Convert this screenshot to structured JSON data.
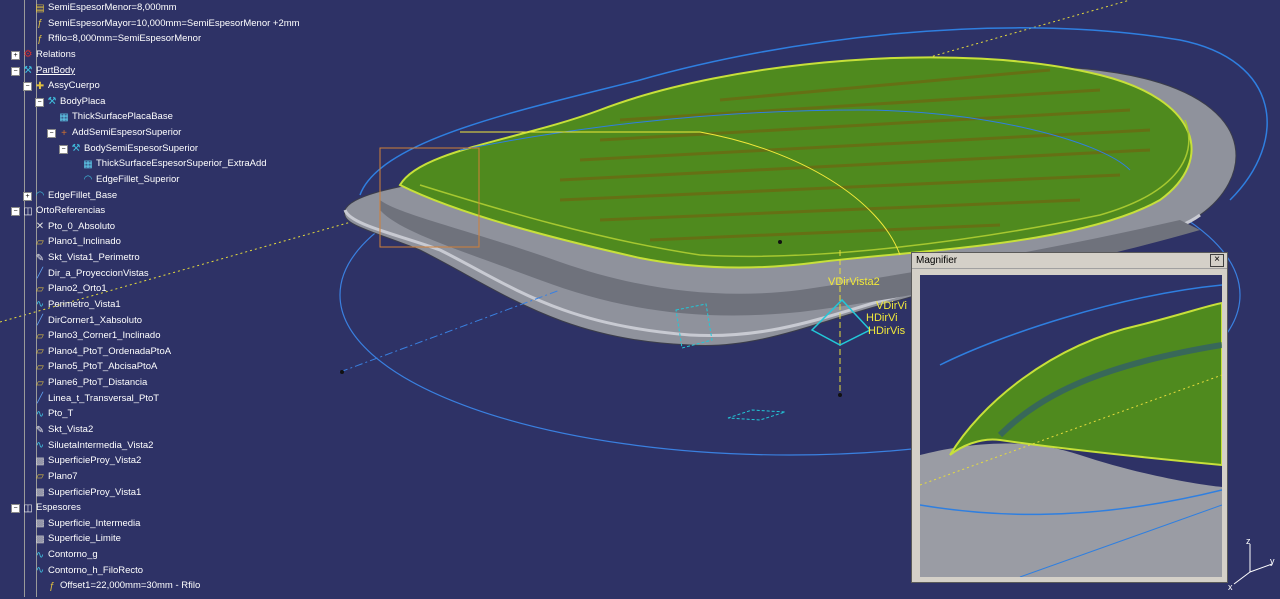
{
  "tree": {
    "nodes": [
      {
        "label": "SemiEspesorMenor=8,000mm",
        "icon": "parameter-icon"
      },
      {
        "label": "SemiEspesorMayor=10,000mm=SemiEspesorMenor +2mm",
        "icon": "formula-icon"
      },
      {
        "label": "Rfilo=8,000mm=SemiEspesorMenor",
        "icon": "formula-icon"
      },
      {
        "label": "Relations",
        "icon": "relations-icon"
      },
      {
        "label": "PartBody",
        "icon": "partbody-icon"
      },
      {
        "label": "AssyCuerpo",
        "icon": "assemble-icon"
      },
      {
        "label": "BodyPlaca",
        "icon": "body-icon"
      },
      {
        "label": "ThickSurfacePlacaBase",
        "icon": "thick-surface-icon"
      },
      {
        "label": "AddSemiEspesorSuperior",
        "icon": "add-icon"
      },
      {
        "label": "BodySemiEspesorSuperior",
        "icon": "body-icon"
      },
      {
        "label": "ThickSurfaceEspesorSuperior_ExtraAdd",
        "icon": "thick-surface-icon"
      },
      {
        "label": "EdgeFillet_Superior",
        "icon": "edge-fillet-icon"
      },
      {
        "label": "EdgeFillet_Base",
        "icon": "edge-fillet-icon"
      },
      {
        "label": "OrtoReferencias",
        "icon": "geometrical-set-icon"
      },
      {
        "label": "Pto_0_Absoluto",
        "icon": "point-icon"
      },
      {
        "label": "Plano1_Inclinado",
        "icon": "plane-icon"
      },
      {
        "label": "Skt_Vista1_Perimetro",
        "icon": "sketch-icon"
      },
      {
        "label": "Dir_a_ProyeccionVistas",
        "icon": "line-icon"
      },
      {
        "label": "Plano2_Orto1",
        "icon": "plane-icon"
      },
      {
        "label": "Perimetro_Vista1",
        "icon": "curve-icon"
      },
      {
        "label": "DirCorner1_Xabsoluto",
        "icon": "line-icon"
      },
      {
        "label": "Plano3_Corner1_Inclinado",
        "icon": "plane-icon"
      },
      {
        "label": "Plano4_PtoT_OrdenadaPtoA",
        "icon": "plane-icon"
      },
      {
        "label": "Plano5_PtoT_AbcisaPtoA",
        "icon": "plane-icon"
      },
      {
        "label": "Plane6_PtoT_Distancia",
        "icon": "plane-icon"
      },
      {
        "label": "Linea_t_Transversal_PtoT",
        "icon": "line-icon"
      },
      {
        "label": "Pto_T",
        "icon": "curve-icon"
      },
      {
        "label": "Skt_Vista2",
        "icon": "sketch-icon"
      },
      {
        "label": "SiluetaIntermedia_Vista2",
        "icon": "curve-icon"
      },
      {
        "label": "SuperficieProy_Vista2",
        "icon": "surface-icon"
      },
      {
        "label": "Plano7",
        "icon": "plane-icon"
      },
      {
        "label": "SuperficieProy_Vista1",
        "icon": "surface-icon"
      },
      {
        "label": "Espesores",
        "icon": "geometrical-set-icon"
      },
      {
        "label": "Superficie_Intermedia",
        "icon": "surface-icon"
      },
      {
        "label": "Superficie_Limite",
        "icon": "surface-icon"
      },
      {
        "label": "Contorno_g",
        "icon": "curve-icon"
      },
      {
        "label": "Contorno_h_FiloRecto",
        "icon": "curve-icon"
      },
      {
        "label": "Offset1=22,000mm=30mm - Rfilo",
        "icon": "formula-icon"
      }
    ]
  },
  "annotations": {
    "vdir2": "VDirVista2",
    "vdir": "VDirVi",
    "hdir": "HDirVi",
    "hdir2": "HDirVis"
  },
  "magnifier": {
    "title": "Magnifier",
    "close": "×"
  },
  "compass": {
    "x": "x",
    "y": "y",
    "z": "z"
  },
  "colors": {
    "background": "#2e3266",
    "surface_green": "#5b8a1e",
    "edge_yellow": "#c7e03a",
    "gray_body": "#9a9ca4",
    "wire_blue": "#2f7fe0",
    "annotation_yellow": "#f2e93a"
  }
}
